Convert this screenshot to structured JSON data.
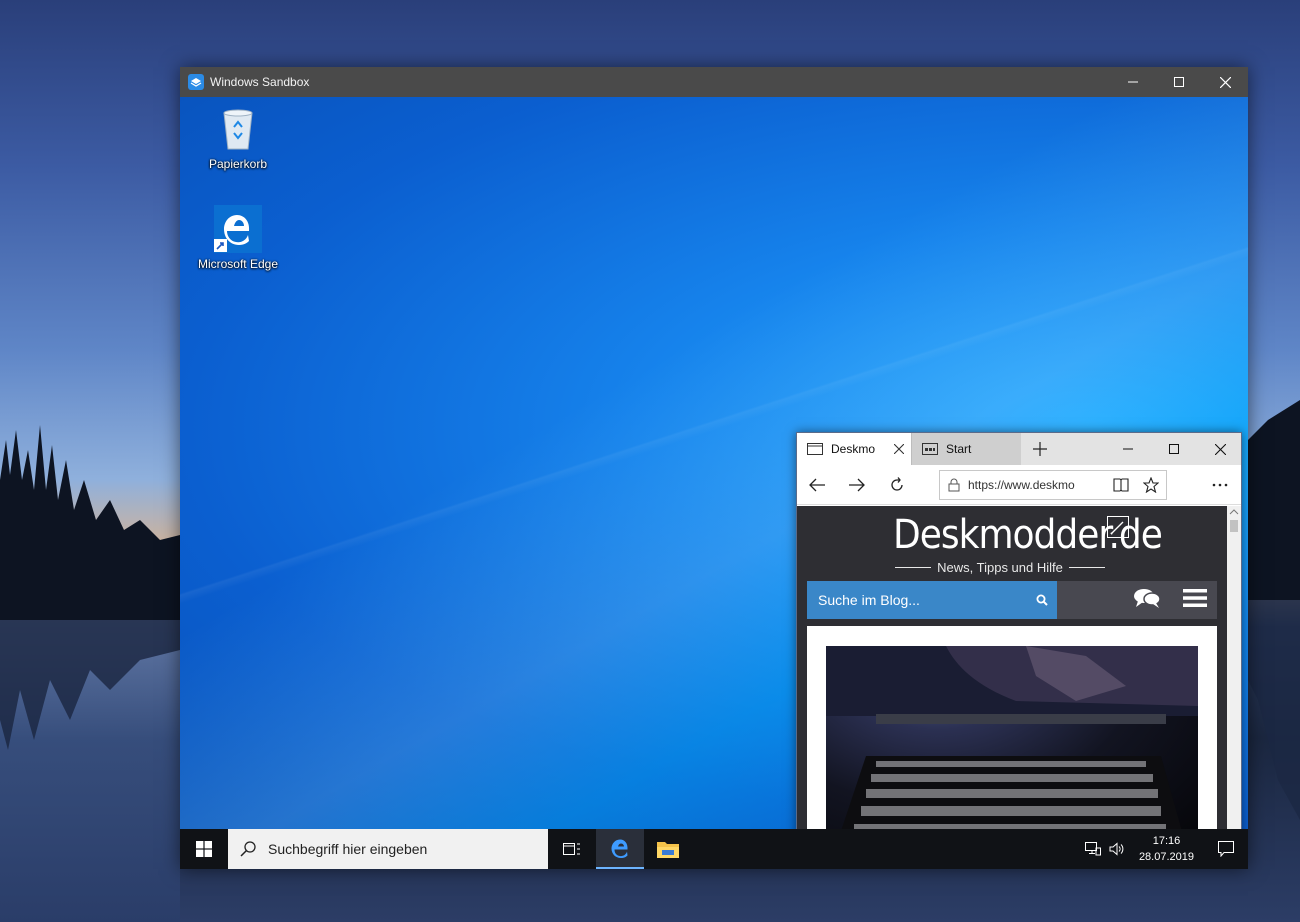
{
  "sandbox": {
    "title": "Windows Sandbox",
    "desktop_icons": {
      "recycle_bin": "Papierkorb",
      "edge": "Microsoft Edge"
    }
  },
  "edge": {
    "tabs": [
      {
        "label": "Deskmo",
        "active": true
      },
      {
        "label": "Start",
        "active": false
      }
    ],
    "address": "https://www.deskmo",
    "site": {
      "logo": "Deskmodder.de",
      "tagline": "News, Tipps und Hilfe",
      "search_placeholder": "Suche im Blog..."
    }
  },
  "taskbar": {
    "search_placeholder": "Suchbegriff hier eingeben",
    "clock_time": "17:16",
    "clock_date": "28.07.2019"
  },
  "colors": {
    "desktop_blue": "#0a66d6",
    "site_search_blue": "#3a87c8",
    "taskbar": "#101216"
  }
}
